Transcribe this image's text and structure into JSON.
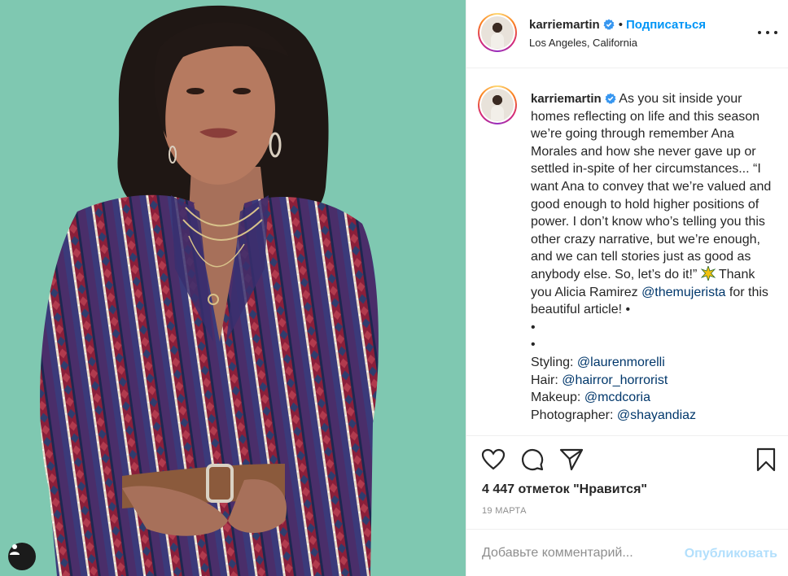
{
  "post": {
    "username": "karriemartin",
    "follow_label": "Подписаться",
    "separator": "•",
    "location": "Los Angeles, California"
  },
  "caption": {
    "username": "karriemartin",
    "text_1": "As you sit inside your homes reflecting on life and this season we’re going through remember Ana Morales and how she never gave up or settled in-spite of her circumstances... “I want Ana to convey that we’re valued and good enough to hold higher positions of power. I don’t know who’s telling you this other crazy narrative, but we’re enough, and we can tell stories just as good as anybody else. So, let’s do it!”",
    "text_2": "Thank you Alicia Ramirez",
    "mention_1": "@themujerista",
    "text_3": "for this beautiful article! •",
    "bullet_1": "•",
    "bullet_2": "•",
    "styling_label": "Styling:",
    "styling_mention": "@laurenmorelli",
    "hair_label": "Hair:",
    "hair_mention": "@hairror_horrorist",
    "makeup_label": "Makeup:",
    "makeup_mention": "@mcdcoria",
    "photo_label": "Photographer:",
    "photo_mention": "@shayandiaz"
  },
  "actions": {
    "likes": "4 447 отметок \"Нравится\"",
    "date": "19 МАРТА"
  },
  "comment_box": {
    "placeholder": "Добавьте комментарий...",
    "publish_label": "Опубликовать"
  },
  "icons": {
    "like": "heart-icon",
    "comment": "comment-icon",
    "share": "share-icon",
    "save": "bookmark-icon",
    "more": "more-icon",
    "verified": "verified-icon",
    "tags": "user-tag-icon"
  },
  "colors": {
    "photo_background": "#7fc8b1",
    "link_blue": "#0095f6",
    "mention_blue": "#00376b",
    "publish_disabled": "#b2dffc",
    "muted_text": "#8e8e8e"
  }
}
